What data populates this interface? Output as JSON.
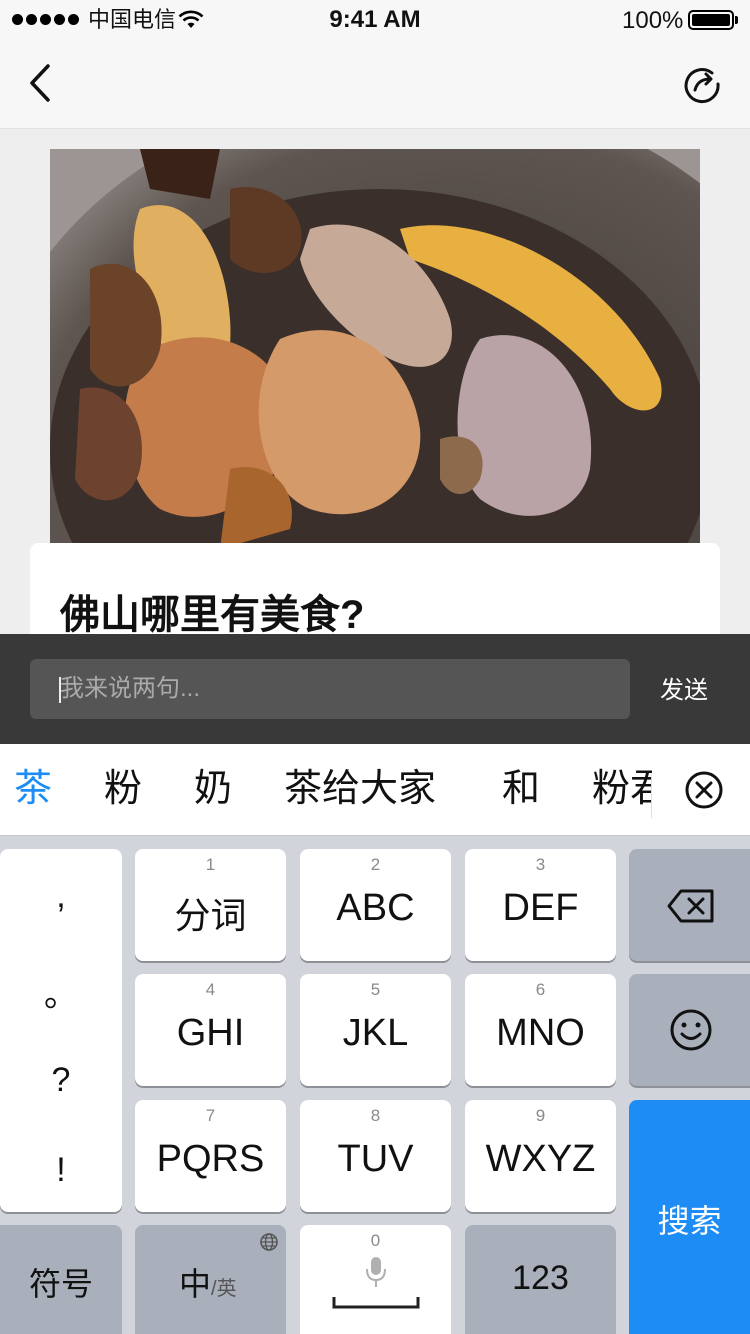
{
  "status_bar": {
    "carrier": "中国电信",
    "time": "9:41 AM",
    "battery": "100%"
  },
  "nav": {
    "back_icon": "chevron-left-icon",
    "share_icon": "share-arrow-icon"
  },
  "post": {
    "image": "food-photo",
    "title": "佛山哪里有美食?"
  },
  "comment": {
    "placeholder": "我来说两句...",
    "send_label": "发送"
  },
  "candidates": {
    "items": [
      "茶",
      "粉",
      "奶",
      "茶给大家",
      "和",
      "粉君"
    ],
    "selected_index": 0,
    "accent": "#1d8cf5"
  },
  "keyboard": {
    "punctuation": [
      ",",
      "。",
      "?",
      "!"
    ],
    "keys": [
      {
        "num": "1",
        "label": "分词"
      },
      {
        "num": "2",
        "label": "ABC"
      },
      {
        "num": "3",
        "label": "DEF"
      },
      {
        "num": "4",
        "label": "GHI"
      },
      {
        "num": "5",
        "label": "JKL"
      },
      {
        "num": "6",
        "label": "MNO"
      },
      {
        "num": "7",
        "label": "PQRS"
      },
      {
        "num": "8",
        "label": "TUV"
      },
      {
        "num": "9",
        "label": "WXYZ"
      }
    ],
    "symbol_label": "符号",
    "lang_main": "中",
    "lang_alt": "/英",
    "space_num": "0",
    "num_label": "123",
    "search_label": "搜索"
  }
}
